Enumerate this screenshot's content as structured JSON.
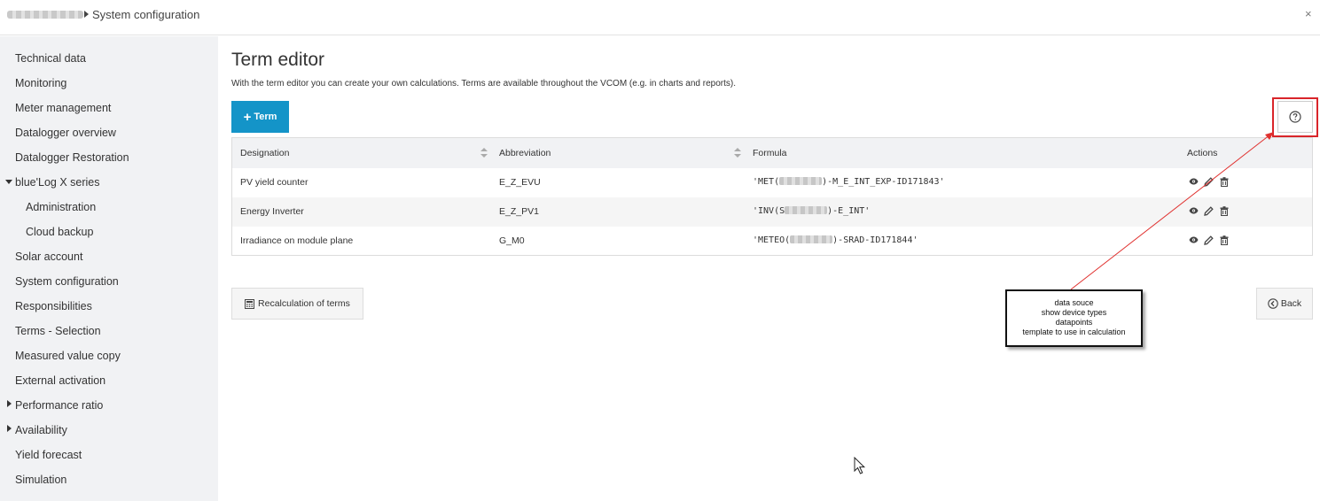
{
  "header": {
    "breadcrumb_title": "System configuration",
    "close_label": "×"
  },
  "sidebar": {
    "items": [
      {
        "label": "Technical data"
      },
      {
        "label": "Monitoring"
      },
      {
        "label": "Meter management"
      },
      {
        "label": "Datalogger overview"
      },
      {
        "label": "Datalogger Restoration"
      },
      {
        "label": "blue'Log X series",
        "expanded": true
      },
      {
        "label": "Administration",
        "sub": true
      },
      {
        "label": "Cloud backup",
        "sub": true
      },
      {
        "label": "Solar account"
      },
      {
        "label": "System configuration"
      },
      {
        "label": "Responsibilities"
      },
      {
        "label": "Terms - Selection"
      },
      {
        "label": "Measured value copy"
      },
      {
        "label": "External activation"
      },
      {
        "label": "Performance ratio",
        "collapsed": true
      },
      {
        "label": "Availability",
        "collapsed": true
      },
      {
        "label": "Yield forecast"
      },
      {
        "label": "Simulation"
      }
    ]
  },
  "main": {
    "title": "Term editor",
    "description": "With the term editor you can create your own calculations. Terms are available throughout the VCOM (e.g. in charts and reports).",
    "add_button_label": "Term",
    "help_icon": "question-circle-icon",
    "table": {
      "columns": [
        "Designation",
        "Abbreviation",
        "Formula",
        "Actions"
      ],
      "rows": [
        {
          "designation": "PV yield counter",
          "abbreviation": "E_Z_EVU",
          "formula_prefix": "'MET(",
          "formula_suffix": ")-M_E_INT_EXP-ID171843'"
        },
        {
          "designation": "Energy Inverter",
          "abbreviation": "E_Z_PV1",
          "formula_prefix": "'INV(S",
          "formula_suffix": ")-E_INT'"
        },
        {
          "designation": "Irradiance on module plane",
          "abbreviation": "G_M0",
          "formula_prefix": "'METEO(",
          "formula_suffix": ")-SRAD-ID171844'"
        }
      ]
    },
    "recalc_button_label": "Recalculation of terms",
    "back_button_label": "Back"
  },
  "annotation": {
    "lines": [
      "data souce",
      "show device types",
      "datapoints",
      "template to use in calculation"
    ],
    "highlight_color": "#d9252a"
  },
  "colors": {
    "accent": "#1494c8",
    "sidebar_bg": "#f1f2f4"
  }
}
